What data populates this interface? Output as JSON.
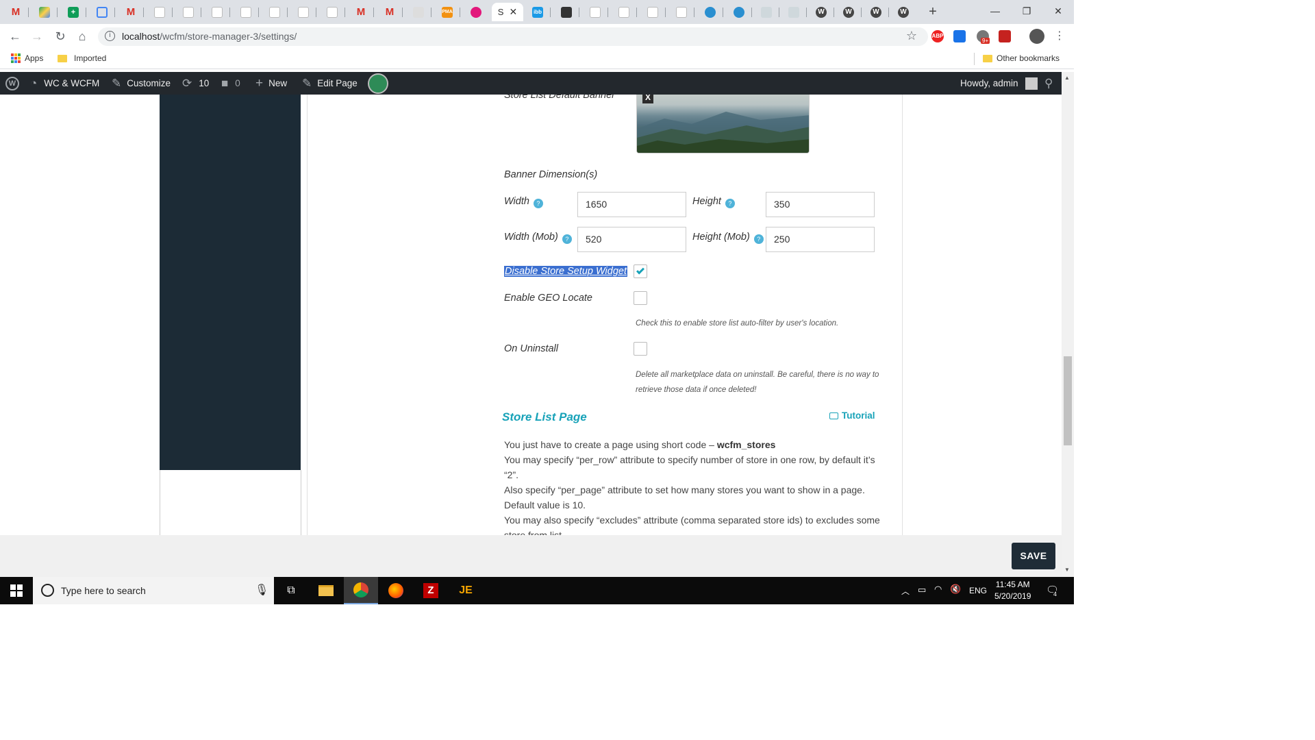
{
  "browser": {
    "active_tab_label": "S",
    "url_host": "localhost",
    "url_path": "/wcfm/store-manager-3/settings/",
    "bookmarks": [
      "Apps",
      "Imported"
    ],
    "other_bookmarks": "Other bookmarks",
    "ext_badge": "9+"
  },
  "adminbar": {
    "site_name": "WC & WCFM",
    "customize": "Customize",
    "updates_count": "10",
    "comments_count": "0",
    "new_label": "New",
    "edit_page": "Edit Page",
    "howdy": "Howdy, admin"
  },
  "settings": {
    "banner_label": "Store List Default Banner",
    "banner_remove": "X",
    "dimensions_heading": "Banner Dimension(s)",
    "width_label": "Width",
    "width_value": "1650",
    "height_label": "Height",
    "height_value": "350",
    "width_mob_label": "Width (Mob)",
    "width_mob_value": "520",
    "height_mob_label": "Height (Mob)",
    "height_mob_value": "250",
    "disable_widget_label": "Disable Store Setup Widget",
    "disable_widget_checked": true,
    "geo_label": "Enable GEO Locate",
    "geo_checked": false,
    "geo_desc": "Check this to enable store list auto-filter by user's location.",
    "uninstall_label": "On Uninstall",
    "uninstall_checked": false,
    "uninstall_desc_1": "Delete all marketplace data on uninstall. Be careful, there is no way to",
    "uninstall_desc_2": "retrieve those data if once deleted!"
  },
  "store_list": {
    "heading": "Store List Page",
    "tutorial": "Tutorial",
    "line1_prefix": "You just have to create a page using short code – ",
    "line1_code": "wcfm_stores",
    "line2": "You may specify “per_row” attribute to specify number of store in one row, by default it’s",
    "line3": "“2”.",
    "line4": "Also specify “per_page” attribute to set how many stores you want to show in a page.",
    "line5": "Default value is 10.",
    "line6": "You may also specify “excludes” attribute (comma separated store ids) to excludes some",
    "line7": "store from list."
  },
  "save_label": "SAVE",
  "taskbar": {
    "search_placeholder": "Type here to search",
    "lang": "ENG",
    "time": "11:45 AM",
    "date": "5/20/2019",
    "notif_count": "4"
  },
  "colors": {
    "accent": "#17a2b8",
    "sidebar": "#1c2b36",
    "adminbar": "#23282d"
  }
}
